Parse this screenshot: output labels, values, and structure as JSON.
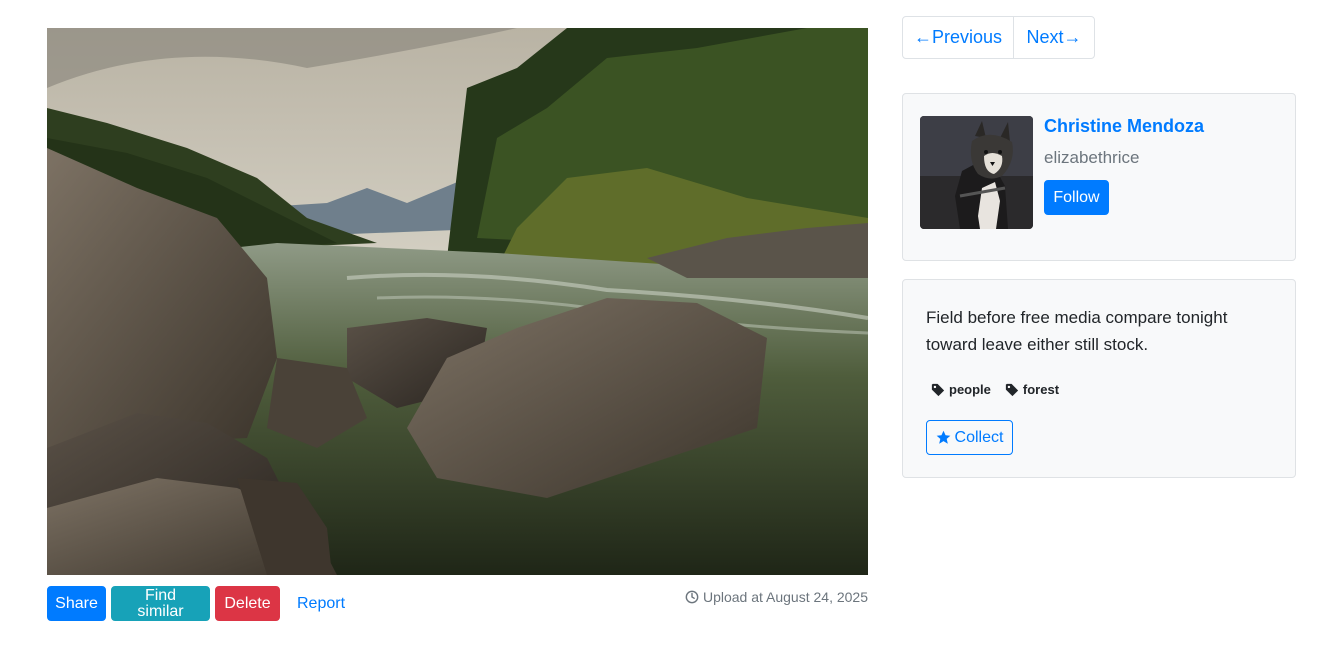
{
  "photo": {
    "alt": "River flowing between forested mountains with large rocks"
  },
  "actions": {
    "share": "Share",
    "find_similar": "Find similar",
    "delete": "Delete",
    "report": "Report"
  },
  "upload": {
    "text": "Upload at August 24, 2025",
    "icon": "clock-icon"
  },
  "pager": {
    "prev": "←Previous",
    "next": "Next→"
  },
  "user": {
    "name": "Christine Mendoza",
    "handle": "elizabethrice",
    "follow": "Follow",
    "avatar": "husky-dog-photo"
  },
  "info": {
    "description": "Field before free media compare tonight toward leave either still stock.",
    "tags": [
      "people",
      "forest"
    ],
    "collect": "Collect"
  },
  "colors": {
    "primary": "#007bff",
    "info": "#17a2b8",
    "danger": "#dc3545",
    "muted": "#6c757d",
    "card_bg": "#f8f9fa"
  }
}
